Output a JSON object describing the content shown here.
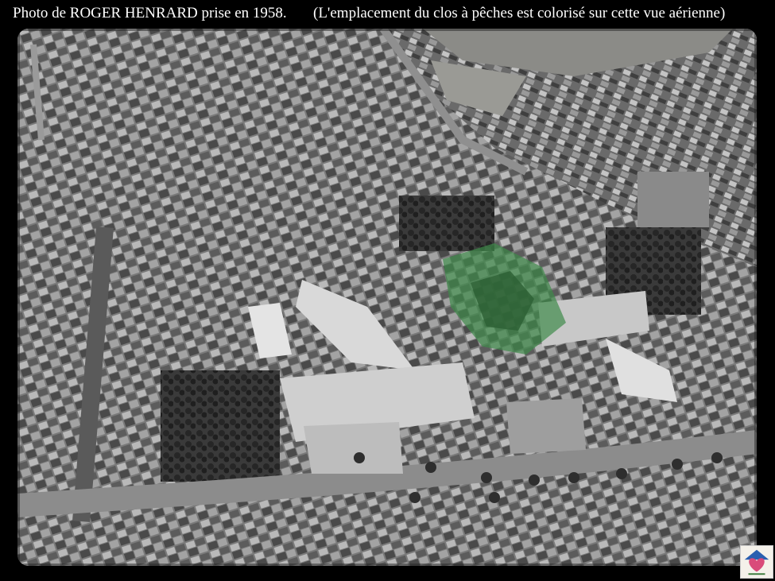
{
  "caption": {
    "main": "Photo de ROGER HENRARD prise en 1958.",
    "note": "(L'emplacement du clos à pêches est colorisé sur cette vue aérienne)"
  },
  "photo": {
    "style": "black-and-white aerial view",
    "highlight_color": "#3f8a4a"
  },
  "logo": {
    "icon": "heart-house-logo"
  }
}
